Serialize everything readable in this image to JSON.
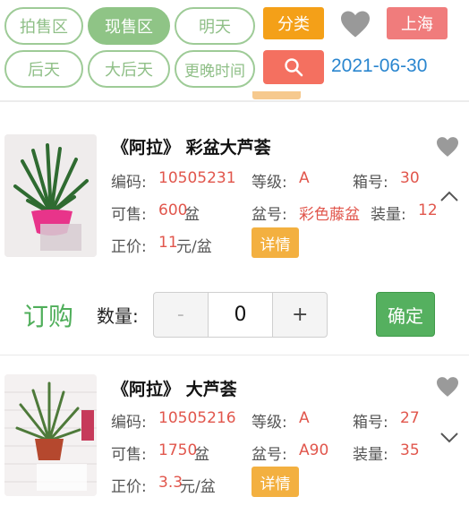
{
  "filters": {
    "tabs": [
      "拍售区",
      "现售区",
      "明天",
      "后天",
      "大后天",
      "更晚时间"
    ],
    "active_tab": "现售区",
    "category_label": "分类",
    "city_label": "上海",
    "date_value": "2021-06-30",
    "search_icon": "search-icon",
    "favorite_icon": "heart-icon"
  },
  "products": [
    {
      "title": "《阿拉》 彩盆大芦荟",
      "code_label": "编码:",
      "code_value": "10505231",
      "grade_label": "等级:",
      "grade_value": "A",
      "box_label": "箱号:",
      "box_value": "30",
      "available_label": "可售:",
      "available_value": "600",
      "available_unit": "盆",
      "pot_label": "盆号:",
      "pot_value": "彩色藤盆",
      "pack_label": "装量:",
      "pack_value": "12",
      "price_label": "正价:",
      "price_value": "11",
      "price_unit": "元/盆",
      "details_label": "详情",
      "expand_icon": "chevron-up-icon"
    },
    {
      "title": "《阿拉》 大芦荟",
      "code_label": "编码:",
      "code_value": "10505216",
      "grade_label": "等级:",
      "grade_value": "A",
      "box_label": "箱号:",
      "box_value": "27",
      "available_label": "可售:",
      "available_value": "1750",
      "available_unit": "盆",
      "pot_label": "盆号:",
      "pot_value": "A90",
      "pack_label": "装量:",
      "pack_value": "35",
      "price_label": "正价:",
      "price_value": "3.3",
      "price_unit": "元/盆",
      "details_label": "详情",
      "expand_icon": "chevron-down-icon"
    }
  ],
  "order": {
    "order_label": "订购",
    "quantity_label": "数量:",
    "minus_label": "-",
    "quantity_value": "0",
    "plus_label": "+",
    "confirm_label": "确定"
  },
  "colors": {
    "accent_green": "#8fc486",
    "orange": "#f4a018",
    "red": "#f07c7c",
    "price_red": "#e1564c",
    "date_blue": "#2a86cf",
    "confirm_green": "#55b05f"
  }
}
